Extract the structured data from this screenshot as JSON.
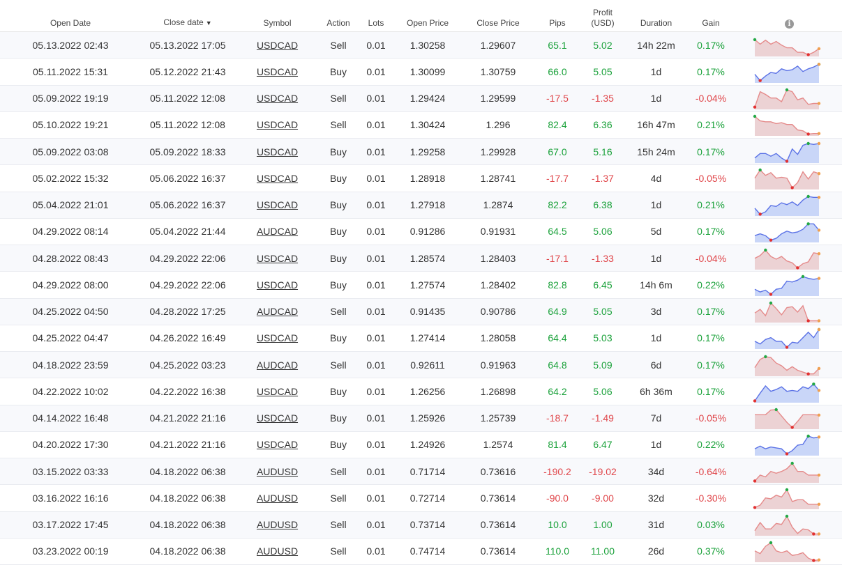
{
  "colors": {
    "positive": "#1aa13a",
    "negative": "#e0464a",
    "win_fill": "#c9d6f8",
    "win_line": "#5b72e6",
    "loss_fill": "#ecd2d4",
    "loss_line": "#e58a8a",
    "max_marker": "#22a845",
    "min_marker": "#e23030",
    "end_marker": "#f0a050"
  },
  "header": {
    "open_date": "Open Date",
    "close_date": "Close date",
    "close_date_sort_glyph": "▼",
    "symbol": "Symbol",
    "action": "Action",
    "lots": "Lots",
    "open_price": "Open Price",
    "close_price": "Close Price",
    "pips": "Pips",
    "profit_line1": "Profit",
    "profit_line2": "(USD)",
    "duration": "Duration",
    "gain": "Gain",
    "info_icon": "info-icon"
  },
  "rows": [
    {
      "open_date": "05.13.2022 02:43",
      "close_date": "05.13.2022 17:05",
      "symbol": "USDCAD",
      "action": "Sell",
      "lots": "0.01",
      "open_price": "1.30258",
      "close_price": "1.29607",
      "pips": "65.1",
      "profit": "5.02",
      "duration": "14h 22m",
      "gain": "0.17%",
      "positive": true,
      "spark": [
        0.85,
        0.6,
        0.82,
        0.6,
        0.75,
        0.55,
        0.4,
        0.4,
        0.15,
        0.15,
        0.02,
        0.15,
        0.35
      ]
    },
    {
      "open_date": "05.11.2022 15:31",
      "close_date": "05.12.2022 21:43",
      "symbol": "USDCAD",
      "action": "Buy",
      "lots": "0.01",
      "open_price": "1.30099",
      "close_price": "1.30759",
      "pips": "66.0",
      "profit": "5.05",
      "duration": "1d",
      "gain": "0.17%",
      "positive": true,
      "spark": [
        0.4,
        0.05,
        0.3,
        0.5,
        0.45,
        0.7,
        0.6,
        0.65,
        0.85,
        0.55,
        0.7,
        0.8,
        0.95
      ]
    },
    {
      "open_date": "05.09.2022 19:19",
      "close_date": "05.11.2022 12:08",
      "symbol": "USDCAD",
      "action": "Sell",
      "lots": "0.01",
      "open_price": "1.29424",
      "close_price": "1.29599",
      "pips": "-17.5",
      "profit": "-1.35",
      "duration": "1d",
      "gain": "-0.04%",
      "positive": false,
      "spark": [
        0.05,
        0.9,
        0.75,
        0.55,
        0.55,
        0.35,
        1.0,
        0.9,
        0.45,
        0.55,
        0.2,
        0.25,
        0.25
      ]
    },
    {
      "open_date": "05.10.2022 19:21",
      "close_date": "05.11.2022 12:08",
      "symbol": "USDCAD",
      "action": "Sell",
      "lots": "0.01",
      "open_price": "1.30424",
      "close_price": "1.296",
      "pips": "82.4",
      "profit": "6.36",
      "duration": "16h 47m",
      "gain": "0.21%",
      "positive": true,
      "spark": [
        1.0,
        0.75,
        0.7,
        0.7,
        0.6,
        0.65,
        0.55,
        0.55,
        0.25,
        0.2,
        0.02,
        0.05,
        0.05
      ]
    },
    {
      "open_date": "05.09.2022 03:08",
      "close_date": "05.09.2022 18:33",
      "symbol": "USDCAD",
      "action": "Buy",
      "lots": "0.01",
      "open_price": "1.29258",
      "close_price": "1.29928",
      "pips": "67.0",
      "profit": "5.16",
      "duration": "15h 24m",
      "gain": "0.17%",
      "positive": true,
      "spark": [
        0.2,
        0.45,
        0.45,
        0.3,
        0.45,
        0.2,
        0.02,
        0.7,
        0.4,
        0.9,
        1.0,
        0.95,
        1.0
      ]
    },
    {
      "open_date": "05.02.2022 15:32",
      "close_date": "05.06.2022 16:37",
      "symbol": "USDCAD",
      "action": "Buy",
      "lots": "0.01",
      "open_price": "1.28918",
      "close_price": "1.28741",
      "pips": "-17.7",
      "profit": "-1.37",
      "duration": "4d",
      "gain": "-0.05%",
      "positive": false,
      "spark": [
        0.55,
        1.0,
        0.7,
        0.85,
        0.55,
        0.6,
        0.55,
        0.02,
        0.3,
        0.9,
        0.5,
        0.9,
        0.8
      ]
    },
    {
      "open_date": "05.04.2022 21:01",
      "close_date": "05.06.2022 16:37",
      "symbol": "USDCAD",
      "action": "Buy",
      "lots": "0.01",
      "open_price": "1.27918",
      "close_price": "1.2874",
      "pips": "82.2",
      "profit": "6.38",
      "duration": "1d",
      "gain": "0.21%",
      "positive": true,
      "spark": [
        0.35,
        0.02,
        0.15,
        0.5,
        0.45,
        0.65,
        0.55,
        0.7,
        0.5,
        0.8,
        1.0,
        0.95,
        0.95
      ]
    },
    {
      "open_date": "04.29.2022 08:14",
      "close_date": "05.04.2022 21:44",
      "symbol": "AUDCAD",
      "action": "Buy",
      "lots": "0.01",
      "open_price": "0.91286",
      "close_price": "0.91931",
      "pips": "64.5",
      "profit": "5.06",
      "duration": "5d",
      "gain": "0.17%",
      "positive": true,
      "spark": [
        0.3,
        0.4,
        0.3,
        0.05,
        0.15,
        0.4,
        0.55,
        0.45,
        0.5,
        0.65,
        0.95,
        0.95,
        0.6
      ]
    },
    {
      "open_date": "04.28.2022 08:43",
      "close_date": "04.29.2022 22:06",
      "symbol": "USDCAD",
      "action": "Buy",
      "lots": "0.01",
      "open_price": "1.28574",
      "close_price": "1.28403",
      "pips": "-17.1",
      "profit": "-1.33",
      "duration": "1d",
      "gain": "-0.04%",
      "positive": false,
      "spark": [
        0.55,
        0.7,
        1.0,
        0.65,
        0.5,
        0.65,
        0.4,
        0.3,
        0.02,
        0.25,
        0.35,
        0.85,
        0.8
      ]
    },
    {
      "open_date": "04.29.2022 08:00",
      "close_date": "04.29.2022 22:06",
      "symbol": "USDCAD",
      "action": "Buy",
      "lots": "0.01",
      "open_price": "1.27574",
      "close_price": "1.28402",
      "pips": "82.8",
      "profit": "6.45",
      "duration": "14h 6m",
      "gain": "0.22%",
      "positive": true,
      "spark": [
        0.3,
        0.15,
        0.25,
        0.02,
        0.3,
        0.35,
        0.75,
        0.7,
        0.8,
        1.0,
        0.9,
        0.85,
        0.9
      ]
    },
    {
      "open_date": "04.25.2022 04:50",
      "close_date": "04.28.2022 17:25",
      "symbol": "AUDCAD",
      "action": "Sell",
      "lots": "0.01",
      "open_price": "0.91435",
      "close_price": "0.90786",
      "pips": "64.9",
      "profit": "5.05",
      "duration": "3d",
      "gain": "0.17%",
      "positive": true,
      "spark": [
        0.45,
        0.65,
        0.3,
        1.0,
        0.7,
        0.35,
        0.75,
        0.8,
        0.5,
        0.85,
        0.02,
        0.02,
        0.02
      ]
    },
    {
      "open_date": "04.25.2022 04:47",
      "close_date": "04.26.2022 16:49",
      "symbol": "USDCAD",
      "action": "Buy",
      "lots": "0.01",
      "open_price": "1.27414",
      "close_price": "1.28058",
      "pips": "64.4",
      "profit": "5.03",
      "duration": "1d",
      "gain": "0.17%",
      "positive": true,
      "spark": [
        0.35,
        0.2,
        0.45,
        0.55,
        0.35,
        0.35,
        0.02,
        0.3,
        0.25,
        0.55,
        0.85,
        0.55,
        1.0
      ]
    },
    {
      "open_date": "04.18.2022 23:59",
      "close_date": "04.25.2022 03:23",
      "symbol": "AUDCAD",
      "action": "Sell",
      "lots": "0.01",
      "open_price": "0.92611",
      "close_price": "0.91963",
      "pips": "64.8",
      "profit": "5.09",
      "duration": "6d",
      "gain": "0.17%",
      "positive": true,
      "spark": [
        0.4,
        0.85,
        1.0,
        0.95,
        0.65,
        0.5,
        0.25,
        0.45,
        0.25,
        0.15,
        0.05,
        0.05,
        0.35
      ]
    },
    {
      "open_date": "04.22.2022 10:02",
      "close_date": "04.22.2022 16:38",
      "symbol": "USDCAD",
      "action": "Buy",
      "lots": "0.01",
      "open_price": "1.26256",
      "close_price": "1.26898",
      "pips": "64.2",
      "profit": "5.06",
      "duration": "6h 36m",
      "gain": "0.17%",
      "positive": true,
      "spark": [
        0.02,
        0.45,
        0.85,
        0.55,
        0.65,
        0.8,
        0.55,
        0.6,
        0.55,
        0.8,
        0.7,
        0.95,
        0.6
      ]
    },
    {
      "open_date": "04.14.2022 16:48",
      "close_date": "04.21.2022 21:16",
      "symbol": "USDCAD",
      "action": "Buy",
      "lots": "0.01",
      "open_price": "1.25926",
      "close_price": "1.25739",
      "pips": "-18.7",
      "profit": "-1.49",
      "duration": "7d",
      "gain": "-0.05%",
      "positive": false,
      "spark": [
        0.72,
        0.72,
        0.72,
        0.98,
        1.0,
        0.65,
        0.3,
        0.02,
        0.35,
        0.72,
        0.72,
        0.72,
        0.7
      ]
    },
    {
      "open_date": "04.20.2022 17:30",
      "close_date": "04.21.2022 21:16",
      "symbol": "USDCAD",
      "action": "Buy",
      "lots": "0.01",
      "open_price": "1.24926",
      "close_price": "1.2574",
      "pips": "81.4",
      "profit": "6.47",
      "duration": "1d",
      "gain": "0.22%",
      "positive": true,
      "spark": [
        0.3,
        0.45,
        0.3,
        0.4,
        0.35,
        0.3,
        0.02,
        0.2,
        0.5,
        0.55,
        1.0,
        0.9,
        0.95
      ]
    },
    {
      "open_date": "03.15.2022 03:33",
      "close_date": "04.18.2022 06:38",
      "symbol": "AUDUSD",
      "action": "Sell",
      "lots": "0.01",
      "open_price": "0.71714",
      "close_price": "0.73616",
      "pips": "-190.2",
      "profit": "-19.02",
      "duration": "34d",
      "gain": "-0.64%",
      "positive": false,
      "spark": [
        0.02,
        0.35,
        0.25,
        0.55,
        0.45,
        0.55,
        0.7,
        1.0,
        0.55,
        0.55,
        0.35,
        0.35,
        0.35
      ]
    },
    {
      "open_date": "03.16.2022 16:16",
      "close_date": "04.18.2022 06:38",
      "symbol": "AUDUSD",
      "action": "Sell",
      "lots": "0.01",
      "open_price": "0.72714",
      "close_price": "0.73614",
      "pips": "-90.0",
      "profit": "-9.00",
      "duration": "32d",
      "gain": "-0.30%",
      "positive": false,
      "spark": [
        0.02,
        0.15,
        0.55,
        0.5,
        0.7,
        0.6,
        1.0,
        0.35,
        0.45,
        0.45,
        0.2,
        0.2,
        0.2
      ]
    },
    {
      "open_date": "03.17.2022 17:45",
      "close_date": "04.18.2022 06:38",
      "symbol": "AUDUSD",
      "action": "Sell",
      "lots": "0.01",
      "open_price": "0.73714",
      "close_price": "0.73614",
      "pips": "10.0",
      "profit": "1.00",
      "duration": "31d",
      "gain": "0.03%",
      "positive": true,
      "spark": [
        0.2,
        0.65,
        0.3,
        0.3,
        0.6,
        0.55,
        1.0,
        0.4,
        0.05,
        0.3,
        0.25,
        0.02,
        0.02
      ]
    },
    {
      "open_date": "03.23.2022 00:19",
      "close_date": "04.18.2022 06:38",
      "symbol": "AUDUSD",
      "action": "Sell",
      "lots": "0.01",
      "open_price": "0.74714",
      "close_price": "0.73614",
      "pips": "110.0",
      "profit": "11.00",
      "duration": "26d",
      "gain": "0.37%",
      "positive": true,
      "spark": [
        0.55,
        0.4,
        0.8,
        1.0,
        0.55,
        0.45,
        0.55,
        0.3,
        0.35,
        0.45,
        0.15,
        0.02,
        0.05
      ]
    }
  ]
}
